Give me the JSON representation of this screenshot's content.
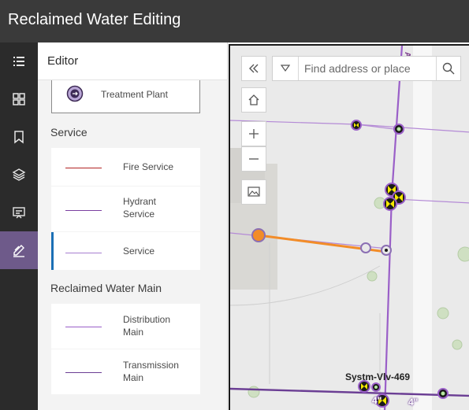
{
  "header": {
    "title": "Reclaimed Water Editing"
  },
  "rail": {
    "items": [
      {
        "name": "legend-icon"
      },
      {
        "name": "basemap-gallery-icon"
      },
      {
        "name": "bookmarks-icon"
      },
      {
        "name": "layers-icon"
      },
      {
        "name": "presentation-icon"
      },
      {
        "name": "edit-icon",
        "active": true
      }
    ],
    "active_color": "#6e5a8a"
  },
  "editor": {
    "title": "Editor",
    "top_item": {
      "label": "Treatment Plant"
    },
    "sections": [
      {
        "title": "Service",
        "items": [
          {
            "label": "Fire Service",
            "line_color": "#b22222"
          },
          {
            "label": "Hydrant Service",
            "line_color": "#7b3fa0"
          },
          {
            "label": "Service",
            "line_color": "#a77fd0"
          }
        ]
      },
      {
        "title": "Reclaimed Water Main",
        "items": [
          {
            "label": "Distribution Main",
            "line_color": "#9a5fc8"
          },
          {
            "label": "Transmission Main",
            "line_color": "#6b3e94"
          }
        ]
      }
    ]
  },
  "map": {
    "search": {
      "placeholder": "Find address or place"
    },
    "labels": {
      "valve": "Systm-Vlv-469",
      "size_a": "4\"",
      "size_b": "4\""
    },
    "colors": {
      "main": "#9a5fc8",
      "service": "#b48ad6",
      "selected": "#f28c28",
      "valve": "#f5e800"
    }
  }
}
